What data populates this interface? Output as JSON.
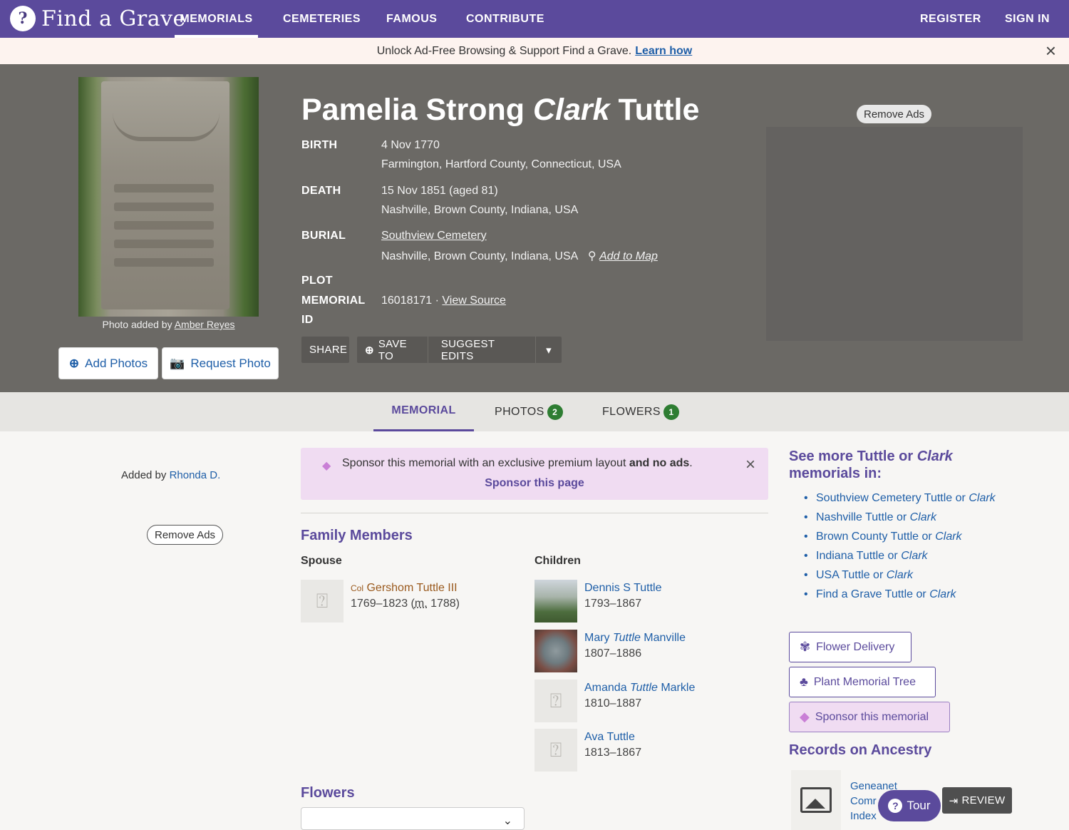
{
  "nav": {
    "logo_text": "Find a Grave",
    "items": [
      "MEMORIALS",
      "CEMETERIES",
      "FAMOUS",
      "CONTRIBUTE"
    ],
    "register": "REGISTER",
    "sign_in": "SIGN IN"
  },
  "promo": {
    "text": "Unlock Ad-Free Browsing & Support Find a Grave.",
    "link": "Learn how",
    "close": "×"
  },
  "hero": {
    "photo_credit_prefix": "Photo added by",
    "photo_credit_name": "Amber Reyes",
    "add_photos": "Add Photos",
    "request_photo": "Request Photo",
    "name_first": "Pamelia Strong",
    "name_maiden": "Clark",
    "name_last": "Tuttle",
    "birth_label": "BIRTH",
    "birth_date": "4 Nov 1770",
    "birth_place": "Farmington, Hartford County, Connecticut, USA",
    "death_label": "DEATH",
    "death_date": "15 Nov 1851 (aged 81)",
    "death_place": "Nashville, Brown County, Indiana, USA",
    "burial_label": "BURIAL",
    "burial_cemetery": "Southview Cemetery",
    "burial_place": "Nashville, Brown County, Indiana, USA",
    "add_to_map": "Add to Map",
    "plot_label": "PLOT",
    "memorial_label": "MEMORIAL",
    "id_label": "ID",
    "memorial_id": "16018171",
    "view_source": "View Source",
    "share": "SHARE",
    "save_to": "SAVE TO",
    "suggest_edits": "SUGGEST EDITS",
    "remove_ads": "Remove Ads"
  },
  "tabs": {
    "memorial": "MEMORIAL",
    "photos": "PHOTOS",
    "photos_count": "2",
    "flowers": "FLOWERS",
    "flowers_count": "1"
  },
  "left": {
    "added_by_prefix": "Added by",
    "added_by_name": "Rhonda D.",
    "remove_ads": "Remove Ads"
  },
  "sponsor": {
    "text": "Sponsor this memorial with an exclusive premium layout",
    "bold": "and no ads",
    "period": ".",
    "link": "Sponsor this page",
    "close": "×"
  },
  "family": {
    "title": "Family Members",
    "spouse_label": "Spouse",
    "children_label": "Children",
    "spouse": {
      "prefix": "Col",
      "name": "Gershom Tuttle III",
      "dates_pre": "1769–1823 (",
      "m": "m.",
      "dates_post": " 1788)"
    },
    "children": [
      {
        "name": "Dennis S Tuttle",
        "dates": "1793–1867"
      },
      {
        "first": "Mary",
        "maiden": "Tuttle",
        "last": "Manville",
        "dates": "1807–1886"
      },
      {
        "first": "Amanda",
        "maiden": "Tuttle",
        "last": "Markle",
        "dates": "1810–1887"
      },
      {
        "name": "Ava Tuttle",
        "dates": "1813–1867"
      }
    ]
  },
  "flowers_title": "Flowers",
  "right": {
    "see_more_prefix": "See more",
    "see_more_name1": "Tuttle",
    "see_more_or": "or",
    "see_more_name2": "Clark",
    "see_more_suffix": "memorials in:",
    "list": [
      {
        "place": "Southview Cemetery Tuttle or",
        "maiden": "Clark"
      },
      {
        "place": "Nashville Tuttle or",
        "maiden": "Clark"
      },
      {
        "place": "Brown County Tuttle or",
        "maiden": "Clark"
      },
      {
        "place": "Indiana Tuttle or",
        "maiden": "Clark"
      },
      {
        "place": "USA Tuttle or",
        "maiden": "Clark"
      },
      {
        "place": "Find a Grave Tuttle or",
        "maiden": "Clark"
      }
    ],
    "flower_delivery": "Flower Delivery",
    "plant_tree": "Plant Memorial Tree",
    "sponsor_memorial": "Sponsor this memorial",
    "records_title": "Records on Ancestry",
    "record_line1": "Geneanet",
    "record_line2": "Comr",
    "record_line3": "Index"
  },
  "widgets": {
    "tour": "Tour",
    "review": "REVIEW"
  }
}
